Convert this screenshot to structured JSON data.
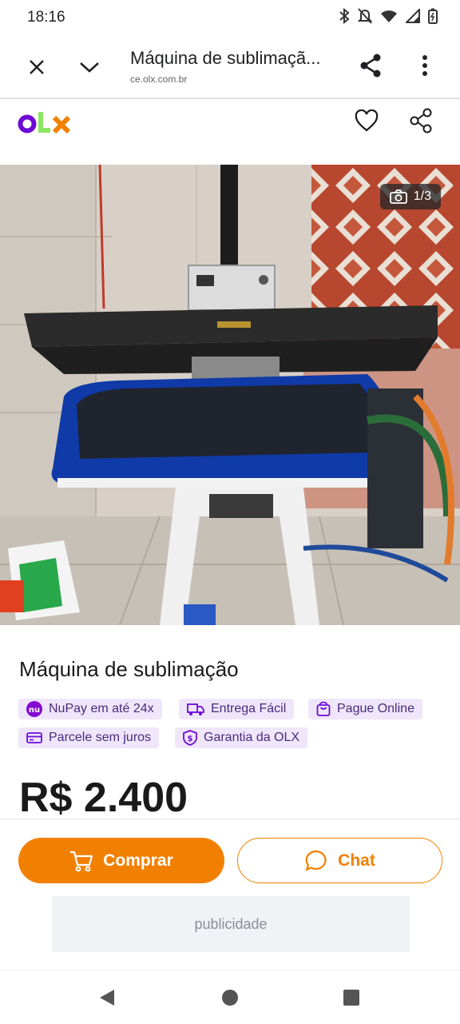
{
  "status": {
    "time": "18:16"
  },
  "browser": {
    "title": "Máquina de sublimaçã...",
    "url": "ce.olx.com.br"
  },
  "photo": {
    "counter": "1/3"
  },
  "listing": {
    "title": "Máquina de sublimação",
    "badges": [
      {
        "label": "NuPay em até 24x",
        "icon": "nu-logo-icon"
      },
      {
        "label": "Entrega Fácil",
        "icon": "delivery-truck-icon"
      },
      {
        "label": "Pague Online",
        "icon": "shopping-bag-icon"
      },
      {
        "label": "Parcele sem juros",
        "icon": "card-icon"
      },
      {
        "label": "Garantia da OLX",
        "icon": "shield-dollar-icon"
      }
    ],
    "price": "R$ 2.400"
  },
  "actions": {
    "buy": "Comprar",
    "chat": "Chat"
  },
  "ad": {
    "label": "publicidade"
  },
  "colors": {
    "accent": "#f28000",
    "badge_bg": "#efe6fc",
    "olx_purple": "#6e0ad6"
  }
}
